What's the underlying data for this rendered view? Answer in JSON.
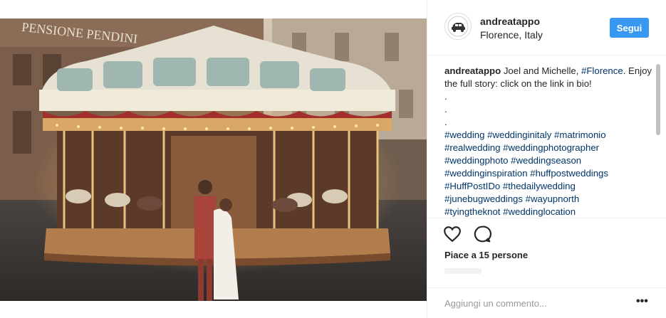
{
  "post": {
    "photo": {
      "sign_text": "PENSIONE PENDINI"
    },
    "author": {
      "username": "andreatappo",
      "location": "Florence, Italy",
      "follow_label": "Segui"
    },
    "caption": {
      "username": "andreatappo",
      "text_before": "Joel and Michelle, ",
      "location_tag": "#Florence",
      "text_after": ". Enjoy the full story: click on the link in bio!",
      "dots": [
        ".",
        ".",
        "."
      ],
      "hashtags": [
        "#wedding",
        "#weddinginitaly",
        "#matrimonio",
        "#realwedding",
        "#weddingphotographer",
        "#weddingphoto",
        "#weddingseason",
        "#weddinginspiration",
        "#huffpostweddings",
        "#HuffPostIDo",
        "#thedailywedding",
        "#junebugweddings",
        "#wayupnorth",
        "#tyingtheknot",
        "#weddinglocation"
      ]
    },
    "likes_text": "Piace a 15 persone",
    "comment_placeholder": "Aggiungi un commento...",
    "more_label": "•••",
    "icons": {
      "like": "heart-icon",
      "comment": "comment-bubble-icon",
      "more": "more-options-icon"
    },
    "colors": {
      "follow_button": "#3897f0",
      "hashtag": "#003569",
      "divider": "#efefef"
    }
  }
}
